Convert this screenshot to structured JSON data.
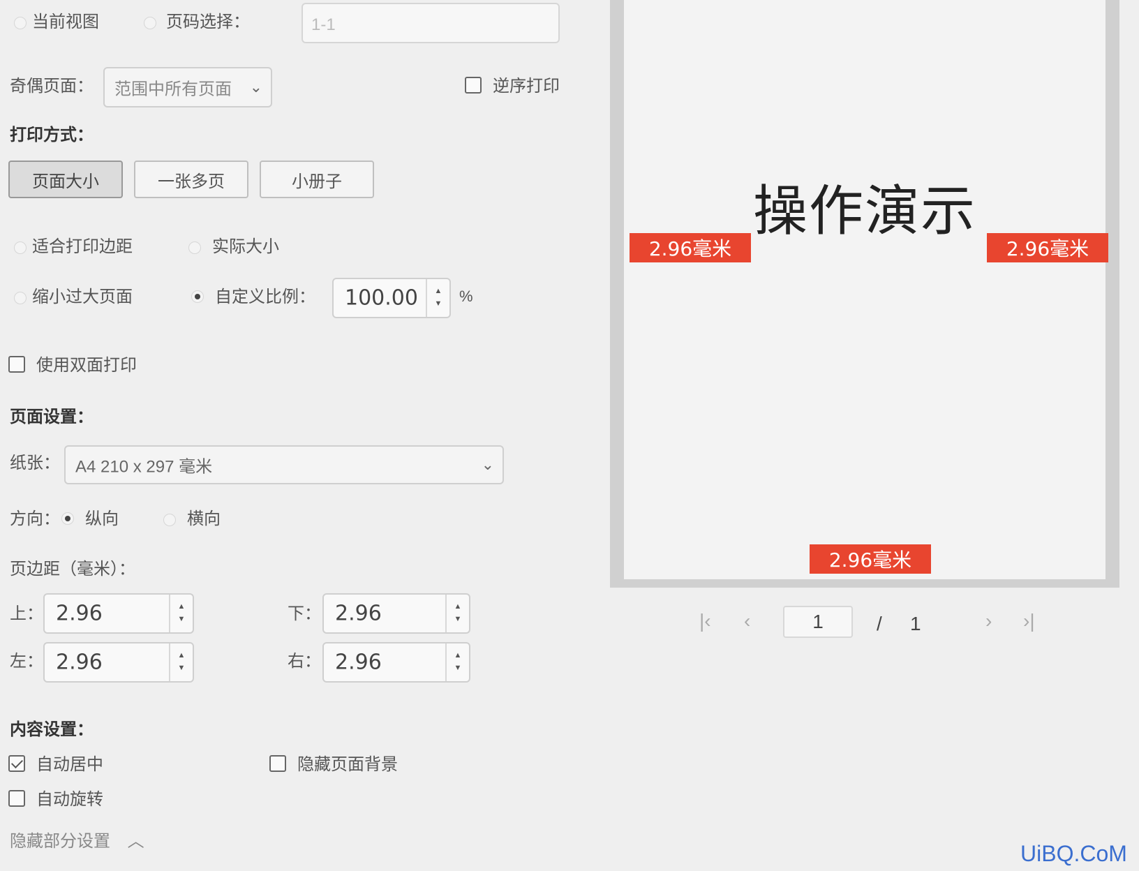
{
  "range": {
    "current_view_label": "当前视图",
    "page_select_label": "页码选择：",
    "page_select_placeholder": "1-1"
  },
  "odd_even": {
    "label": "奇偶页面：",
    "value": "范围中所有页面",
    "reverse_label": "逆序打印"
  },
  "print_mode": {
    "header": "打印方式：",
    "buttons": [
      {
        "label": "页面大小",
        "active": true
      },
      {
        "label": "一张多页",
        "active": false
      },
      {
        "label": "小册子",
        "active": false
      }
    ],
    "fit_margin_label": "适合打印边距",
    "actual_size_label": "实际大小",
    "shrink_label": "缩小过大页面",
    "custom_scale_label": "自定义比例：",
    "custom_scale_value": "100.00",
    "percent_unit": "%"
  },
  "duplex_label": "使用双面打印",
  "page_setup": {
    "header": "页面设置：",
    "paper_label": "纸张：",
    "paper_value": "A4 210 x 297 毫米",
    "orientation_label": "方向：",
    "portrait_label": "纵向",
    "landscape_label": "横向",
    "margins_header": "页边距（毫米）：",
    "top_label": "上：",
    "bottom_label": "下：",
    "left_label": "左：",
    "right_label": "右：",
    "top_value": "2.96",
    "bottom_value": "2.96",
    "left_value": "2.96",
    "right_value": "2.96"
  },
  "content": {
    "header": "内容设置：",
    "auto_center_label": "自动居中",
    "hide_bg_label": "隐藏页面背景",
    "auto_rotate_label": "自动旋转"
  },
  "hidden_section_label": "隐藏部分设置",
  "preview": {
    "title": "操作演示",
    "margin_tag_left": "2.96毫米",
    "margin_tag_right": "2.96毫米",
    "margin_tag_bottom": "2.96毫米",
    "current_page": "1",
    "separator": "/",
    "total_pages": "1",
    "tag_color": "#e8452f"
  },
  "watermark": "UiBQ.CoM"
}
